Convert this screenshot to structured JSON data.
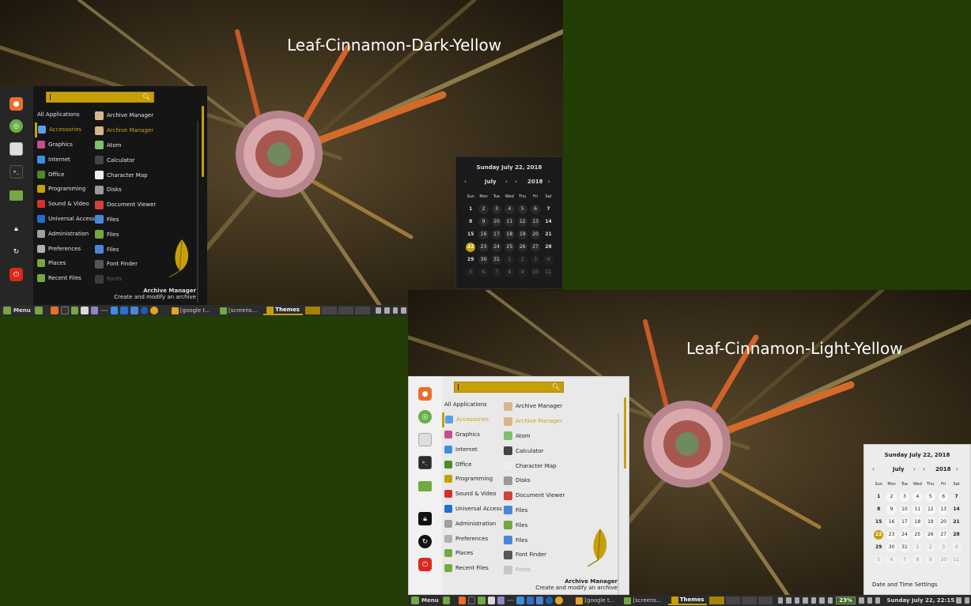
{
  "wallpaper_titles": {
    "dark": "Leaf-Cinnamon-Dark-Yellow",
    "light": "Leaf-Cinnamon-Light-Yellow"
  },
  "menu": {
    "search_placeholder": "",
    "categories": [
      "All Applications",
      "Accessories",
      "Graphics",
      "Internet",
      "Office",
      "Programming",
      "Sound & Video",
      "Universal Access",
      "Administration",
      "Preferences",
      "Places",
      "Recent Files"
    ],
    "category_icon_colors": [
      "",
      "#5aa0e8",
      "#c84d8e",
      "#3c8ee0",
      "#4c8a2a",
      "#c6a009",
      "#d62f2f",
      "#1f6fd0",
      "#a0a0a0",
      "#b0b0b0",
      "#74a842",
      "#74a842"
    ],
    "apps": [
      "Archive Manager",
      "Archive Manager",
      "Atom",
      "Calculator",
      "Character Map",
      "Disks",
      "Document Viewer",
      "Files",
      "Files",
      "Files",
      "Font Finder",
      "Fonts"
    ],
    "app_icon_colors": [
      "#d9b48c",
      "#d9b48c",
      "#7fc06a",
      "#444444",
      "#eeeeee",
      "#9a9a9a",
      "#d3423a",
      "#4a86d8",
      "#74a842",
      "#4a86d8",
      "#555555",
      "#888888"
    ],
    "selected_app": {
      "name": "Archive Manager",
      "description": "Create and modify an archive"
    }
  },
  "calendar": {
    "date_heading": "Sunday July 22, 2018",
    "month": "July",
    "year": "2018",
    "weekdays": [
      "Sun",
      "Mon",
      "Tue",
      "Wed",
      "Thu",
      "Fri",
      "Sat"
    ],
    "weeks": [
      [
        "1",
        "2",
        "3",
        "4",
        "5",
        "6",
        "7"
      ],
      [
        "8",
        "9",
        "10",
        "11",
        "12",
        "13",
        "14"
      ],
      [
        "15",
        "16",
        "17",
        "18",
        "19",
        "20",
        "21"
      ],
      [
        "22",
        "23",
        "24",
        "25",
        "26",
        "27",
        "28"
      ],
      [
        "29",
        "30",
        "31",
        "1",
        "2",
        "3",
        "4"
      ],
      [
        "5",
        "6",
        "7",
        "8",
        "9",
        "10",
        "11"
      ]
    ],
    "today": "22",
    "settings_link": "Date and Time Settings"
  },
  "panel": {
    "menu_label": "Menu",
    "windows": [
      {
        "label": "[google t...",
        "active": false
      },
      {
        "label": "[screens...",
        "active": false
      },
      {
        "label": "Themes",
        "active": true
      }
    ],
    "battery": "23%",
    "clock": "Sunday July 22, 22:15"
  },
  "colors": {
    "accent": "#c6a009",
    "desktop": "#223d05",
    "power": "#d9291c"
  }
}
